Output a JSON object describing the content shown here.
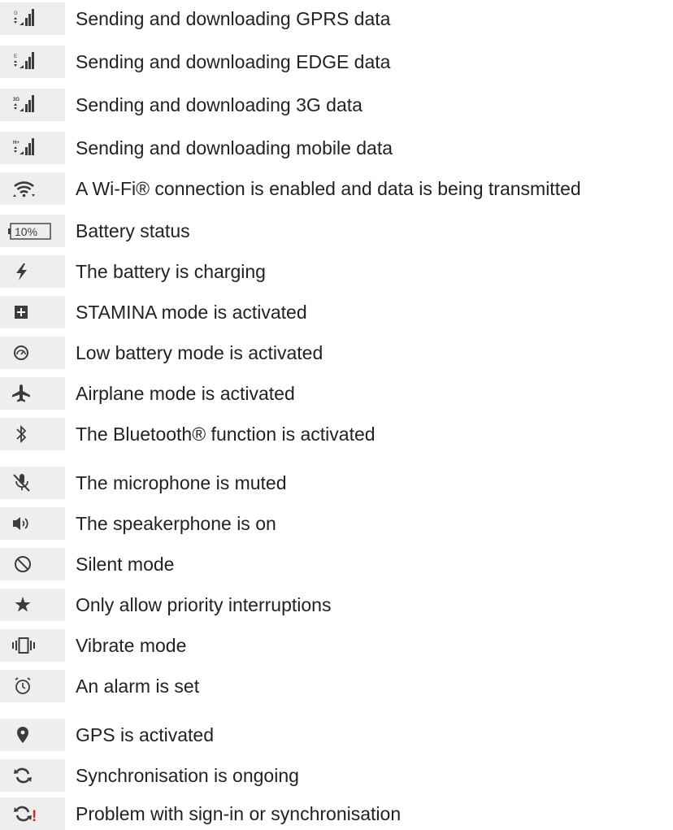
{
  "rows": [
    {
      "icon": "gprs-signal-icon",
      "glyph": "G",
      "text": "Sending and downloading GPRS data"
    },
    {
      "icon": "edge-signal-icon",
      "glyph": "E",
      "text": "Sending and downloading EDGE data"
    },
    {
      "icon": "3g-signal-icon",
      "glyph": "3G",
      "text": "Sending and downloading 3G data"
    },
    {
      "icon": "hplus-signal-icon",
      "glyph": "H+",
      "text": "Sending and downloading mobile data"
    },
    {
      "icon": "wifi-data-icon",
      "text": "A Wi-Fi® connection is enabled and data is being transmitted"
    },
    {
      "icon": "battery-icon",
      "glyph": "10%",
      "text": "Battery status"
    },
    {
      "icon": "charging-bolt-icon",
      "text": "The battery is charging"
    },
    {
      "icon": "stamina-plus-icon",
      "glyph": "+",
      "text": "STAMINA mode is activated"
    },
    {
      "icon": "low-battery-gauge-icon",
      "text": "Low battery mode is activated"
    },
    {
      "icon": "airplane-icon",
      "text": "Airplane mode is activated"
    },
    {
      "icon": "bluetooth-icon",
      "text": "The Bluetooth® function is activated"
    },
    {
      "icon": "microphone-muted-icon",
      "text": "The microphone is muted"
    },
    {
      "icon": "speakerphone-icon",
      "text": "The speakerphone is on"
    },
    {
      "icon": "silent-mode-icon",
      "text": "Silent mode"
    },
    {
      "icon": "star-icon",
      "text": "Only allow priority interruptions"
    },
    {
      "icon": "vibrate-icon",
      "text": "Vibrate mode"
    },
    {
      "icon": "alarm-clock-icon",
      "text": "An alarm is set"
    },
    {
      "icon": "gps-pin-icon",
      "text": "GPS is activated"
    },
    {
      "icon": "sync-icon",
      "text": "Synchronisation is ongoing"
    },
    {
      "icon": "sync-problem-icon",
      "glyph": "!",
      "text": "Problem with sign-in or synchronisation"
    }
  ],
  "colors": {
    "icon_cell_bg": "#eeeeef",
    "icon": "#3c3c3c",
    "text": "#222222",
    "warning": "#e2231a"
  }
}
